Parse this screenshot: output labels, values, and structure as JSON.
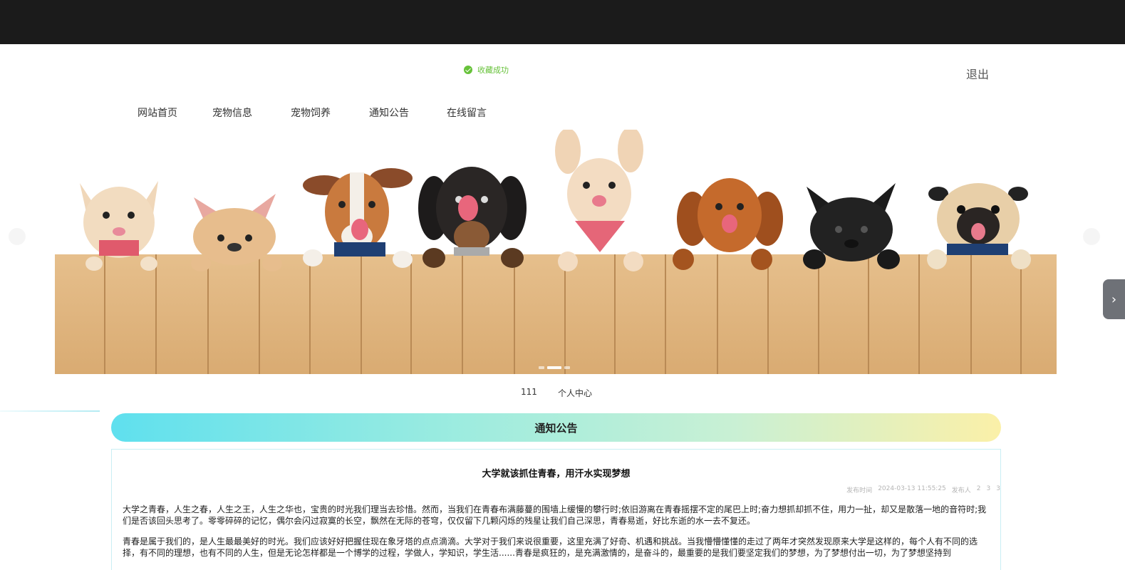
{
  "toast": {
    "text": "收藏成功",
    "icon": "check-circle-icon",
    "color": "#67c23a"
  },
  "header": {
    "logout_label": "退出"
  },
  "nav": {
    "items": [
      {
        "label": "网站首页"
      },
      {
        "label": "宠物信息"
      },
      {
        "label": "宠物饲养"
      },
      {
        "label": "通知公告"
      },
      {
        "label": "在线留言"
      }
    ]
  },
  "banner": {
    "alt": "dogs peeking over wooden fence",
    "active_slide": 2,
    "slide_count": 3
  },
  "userbar": {
    "username": "111",
    "center_label": "个人中心"
  },
  "section": {
    "title": "通知公告"
  },
  "article": {
    "title": "大学就该抓住青春，用汗水实现梦想",
    "meta": {
      "time_label": "发布时间",
      "time_value": "2024-03-13 11:55:25",
      "author_label": "发布人",
      "author_value": "2",
      "likes": "3",
      "comments": "3"
    },
    "paragraphs": [
      "大学之青春，人生之春，人生之王，人生之华也，宝贵的时光我们理当去珍惜。然而，当我们在青春布满藤蔓的围墙上缓慢的攀行时;依旧游离在青春摇摆不定的尾巴上时;奋力想抓却抓不住，用力一扯，却又是散落一地的音符时;我们是否该回头思考了。零零碎碎的记忆，偶尔会闪过寂寞的长空，飘然在无际的苍穹，仅仅留下几颗闪烁的残星让我们自己深思，青春易逝，好比东逝的水一去不复还。",
      "青春是属于我们的，是人生最最美好的时光。我们应该好好把握住现在象牙塔的点点滴滴。大学对于我们来说很重要，这里充满了好奇、机遇和挑战。当我懵懵懂懂的走过了两年才突然发现原来大学是这样的，每个人有不同的选择，有不同的理想，也有不同的人生，但是无论怎样都是一个博学的过程，学做人，学知识，学生活......青春是疯狂的，是充满激情的，是奋斗的，最重要的是我们要坚定我们的梦想，为了梦想付出一切，为了梦想坚持到"
    ]
  }
}
